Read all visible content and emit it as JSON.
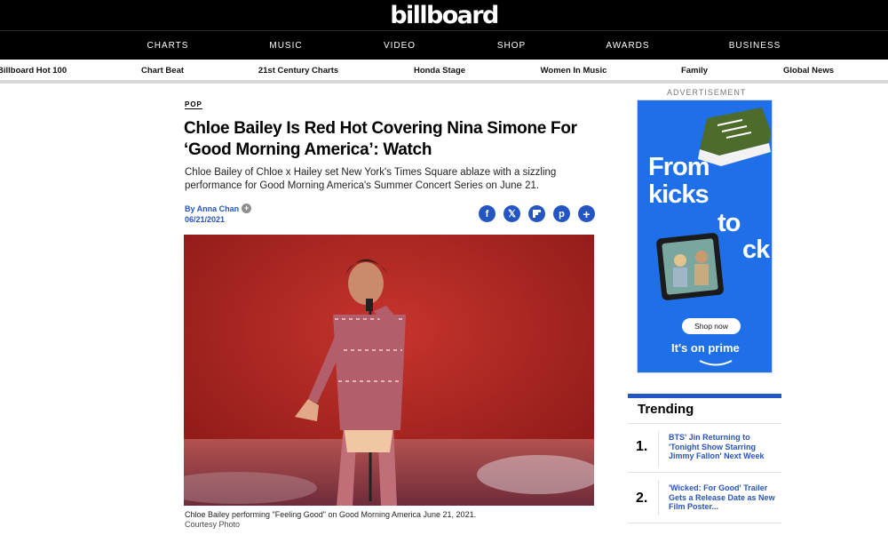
{
  "site": {
    "logo": "billboard"
  },
  "main_nav": [
    "CHARTS",
    "MUSIC",
    "VIDEO",
    "SHOP",
    "AWARDS",
    "BUSINESS"
  ],
  "sub_nav": [
    "Billboard Hot 100",
    "Chart Beat",
    "21st Century Charts",
    "Honda Stage",
    "Women In Music",
    "Family",
    "Global News"
  ],
  "article": {
    "kicker": "POP",
    "headline": "Chloe Bailey Is Red Hot Covering Nina Simone For ‘Good Morning America’: Watch",
    "dek": "Chloe Bailey of Chloe x Hailey set New York's Times Square ablaze with a sizzling performance for Good Morning America's Summer Concert Series on June 21.",
    "byline": "By Anna Chan",
    "date": "06/21/2021",
    "caption": "Chloe Bailey performing \"Feeling Good\" on Good Morning America June 21, 2021.",
    "credit": "Courtesy Photo"
  },
  "share_icons": [
    "facebook-icon",
    "x-icon",
    "flipboard-icon",
    "pinterest-icon",
    "plus-icon"
  ],
  "ad": {
    "label": "ADVERTISEMENT",
    "line1": "From",
    "line2": "kicks",
    "line3": "to",
    "line4": "ck",
    "button": "Shop now",
    "footer": "It's on prime"
  },
  "trending": {
    "title": "Trending",
    "items": [
      {
        "rank": "1.",
        "title": "BTS' Jin Returning to 'Tonight Show Starring Jimmy Fallon' Next Week"
      },
      {
        "rank": "2.",
        "title": "'Wicked: For Good' Trailer Gets a Release Date as New Film Poster..."
      }
    ]
  },
  "colors": {
    "accent": "#2455c3",
    "link": "#2856b6",
    "ad_bg": "#1e6fe8",
    "hero_bg": "#9d1f1d"
  }
}
